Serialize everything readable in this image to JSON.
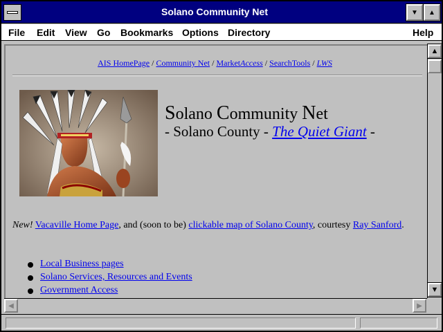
{
  "window": {
    "title": "Solano Community Net"
  },
  "menubar": {
    "items": [
      "File",
      "Edit",
      "View",
      "Go",
      "Bookmarks",
      "Options",
      "Directory",
      "Help"
    ]
  },
  "nav": {
    "links": [
      "AIS HomePage",
      "Community Net",
      "Market",
      "Access",
      "SearchTools",
      "LWS"
    ],
    "separator": " / "
  },
  "page": {
    "heading_line1_initial1": "S",
    "heading_line1_rest1": "olano ",
    "heading_line1_initial2": "C",
    "heading_line1_rest2": "ommunity ",
    "heading_line1_initial3": "N",
    "heading_line1_rest3": "et",
    "heading_line2_prefix": "- Solano County - ",
    "heading_line2_link": "The Quiet Giant",
    "heading_line2_suffix": " -",
    "image_alt": "Native American chief in feathered headdress holding a spear"
  },
  "announcement": {
    "new_label": "New!",
    "link1": "Vacaville Home Page",
    "text1": ", and (soon to be) ",
    "link2": "clickable map of Solano County",
    "text2": ", courtesy ",
    "link3": "Ray Sanford",
    "text3": "."
  },
  "list": {
    "items": [
      "Local Business pages",
      "Solano Services, Resources and Events",
      "Government Access"
    ]
  },
  "status": {
    "text": ""
  },
  "colors": {
    "titlebar": "#000080",
    "link": "#0000ee",
    "background": "#c0c0c0"
  }
}
